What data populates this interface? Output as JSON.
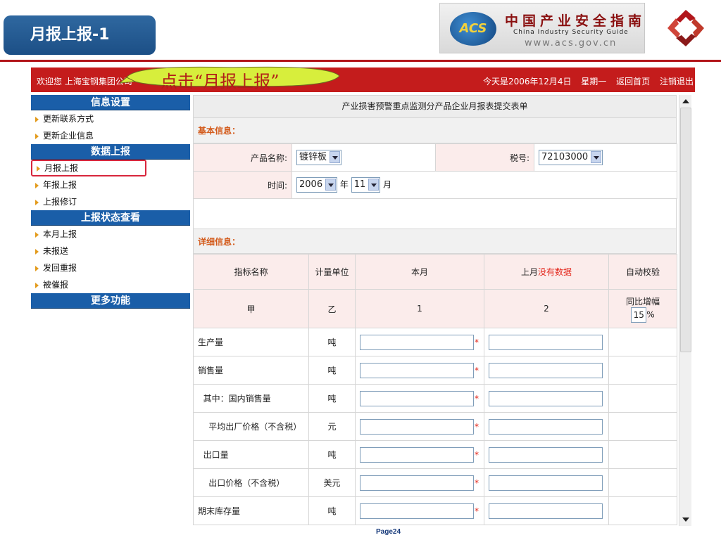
{
  "slide": {
    "title": "月报上报-1",
    "page": "Page24"
  },
  "logo": {
    "badge": "ACS",
    "cn": "中国产业安全指南",
    "en": "China  Industry  Security  Guide",
    "url": "www.acs.gov.cn"
  },
  "topbar": {
    "welcome": "欢迎您  上海宝钢集团公司",
    "date": "今天是2006年12月4日",
    "weekday": "星期一",
    "home": "返回首页",
    "logout": "注销退出"
  },
  "callout": "点击“月报上报”",
  "sidebar": [
    {
      "type": "head",
      "label": "信息设置"
    },
    {
      "type": "item",
      "label": "更新联系方式"
    },
    {
      "type": "item",
      "label": "更新企业信息"
    },
    {
      "type": "head",
      "label": "数据上报"
    },
    {
      "type": "item",
      "label": "月报上报",
      "active": true
    },
    {
      "type": "item",
      "label": "年报上报"
    },
    {
      "type": "item",
      "label": "上报修订"
    },
    {
      "type": "head",
      "label": "上报状态查看"
    },
    {
      "type": "item",
      "label": "本月上报"
    },
    {
      "type": "item",
      "label": "未报送"
    },
    {
      "type": "item",
      "label": "发回重报"
    },
    {
      "type": "item",
      "label": "被催报"
    },
    {
      "type": "head",
      "label": "更多功能"
    }
  ],
  "form": {
    "title": "产业损害预警重点监测分产品企业月报表提交表单",
    "basic_label": "基本信息：",
    "product_label": "产品名称:",
    "product_value": "镀锌板",
    "tax_label": "税号:",
    "tax_value": "72103000",
    "time_label": "时间:",
    "year_value": "2006",
    "year_unit": "年",
    "month_value": "11",
    "month_unit": "月",
    "detail_label": "详细信息：",
    "headers": {
      "name": "指标名称",
      "unit": "计量单位",
      "this_month": "本月",
      "last_month": "上月",
      "no_data": "没有数据",
      "auto": "自动校验"
    },
    "codes": {
      "name": "甲",
      "unit": "乙",
      "this_month": "1",
      "last_month": "2",
      "yoy_label": "同比增幅",
      "yoy_value": "15",
      "yoy_unit": "%"
    },
    "rows": [
      {
        "name": "生产量",
        "unit": "吨"
      },
      {
        "name": "销售量",
        "unit": "吨"
      },
      {
        "name": "  其中：国内销售量",
        "unit": "吨"
      },
      {
        "name": "    平均出厂价格（不含税）",
        "unit": "元"
      },
      {
        "name": "  出口量",
        "unit": "吨"
      },
      {
        "name": "    出口价格（不含税）",
        "unit": "美元"
      },
      {
        "name": "期末库存量",
        "unit": "吨"
      }
    ],
    "required_mark": "*"
  }
}
